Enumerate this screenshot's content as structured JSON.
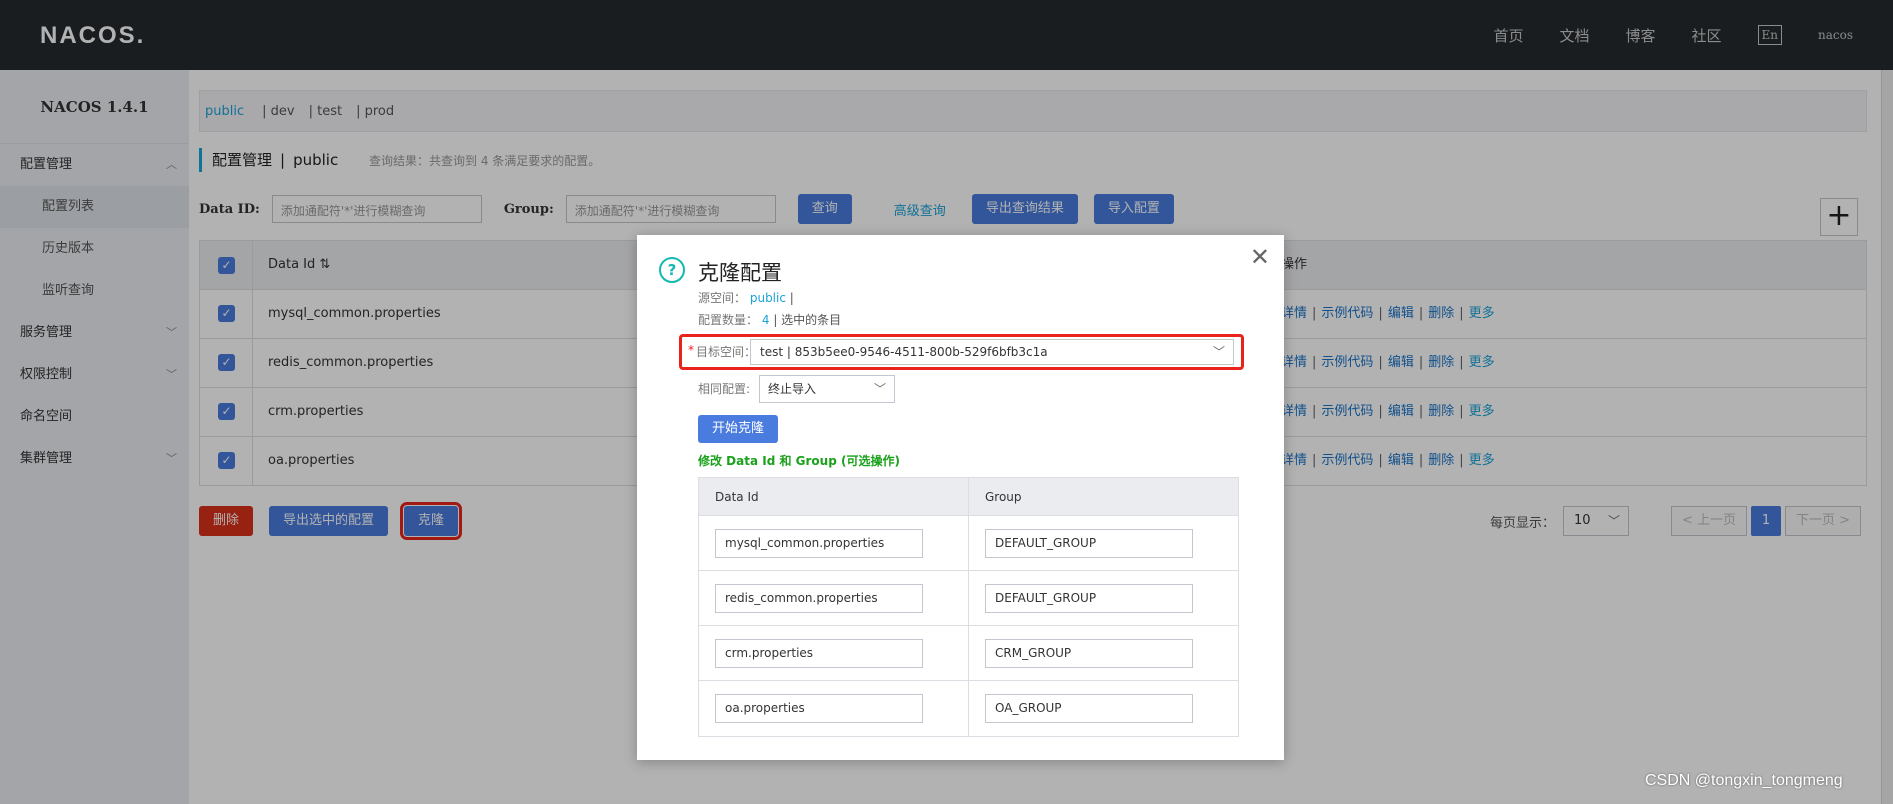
{
  "header": {
    "logo": "NACOS.",
    "nav": [
      "首页",
      "文档",
      "博客",
      "社区"
    ],
    "lang": "En",
    "user": "nacos"
  },
  "sidebar": {
    "version": "NACOS 1.4.1",
    "items": [
      {
        "label": "配置管理",
        "type": "group",
        "chevron": "^"
      },
      {
        "label": "配置列表",
        "type": "sub",
        "active": true
      },
      {
        "label": "历史版本",
        "type": "sub"
      },
      {
        "label": "监听查询",
        "type": "sub"
      },
      {
        "label": "服务管理",
        "type": "group",
        "chevron": "v"
      },
      {
        "label": "权限控制",
        "type": "group",
        "chevron": "v"
      },
      {
        "label": "命名空间",
        "type": "group"
      },
      {
        "label": "集群管理",
        "type": "group",
        "chevron": "v"
      }
    ]
  },
  "namespace_tabs": [
    "public",
    "| dev",
    "| test",
    "| prod"
  ],
  "page": {
    "title": "配置管理",
    "sep": "|",
    "namespace": "public",
    "hint": "查询结果：共查询到 4 条满足要求的配置。"
  },
  "search": {
    "dataid_label": "Data ID:",
    "dataid_placeholder": "添加通配符'*'进行模糊查询",
    "group_label": "Group:",
    "group_placeholder": "添加通配符'*'进行模糊查询",
    "query_btn": "查询",
    "advanced_link": "高级查询",
    "export_btn": "导出查询结果",
    "import_btn": "导入配置",
    "plus": "+"
  },
  "table": {
    "col_dataid": "Data Id",
    "sort_icon": "⇅",
    "col_ops": "操作",
    "rows": [
      {
        "data_id": "mysql_common.properties"
      },
      {
        "data_id": "redis_common.properties"
      },
      {
        "data_id": "crm.properties"
      },
      {
        "data_id": "oa.properties"
      }
    ],
    "ops": [
      "详情",
      "示例代码",
      "编辑",
      "删除",
      "更多"
    ],
    "ops_sep": "|"
  },
  "actions": {
    "delete": "删除",
    "export_selected": "导出选中的配置",
    "clone": "克隆"
  },
  "pager": {
    "per_page_label": "每页显示：",
    "per_page": "10",
    "prev": "< 上一页",
    "current": "1",
    "next": "下一页 >"
  },
  "dialog": {
    "title": "克隆配置",
    "source_label": "源空间：",
    "source_value": "public",
    "source_sep": "|",
    "count_label": "配置数量：",
    "count_value": "4",
    "count_suffix": "| 选中的条目",
    "target_required": "*",
    "target_label": "目标空间：",
    "target_value": "test | 853b5ee0-9546-4511-800b-529f6bfb3c1a",
    "same_label": "相同配置:",
    "same_value": "终止导入",
    "start_btn": "开始克隆",
    "edit_hint": "修改 Data Id 和 Group (可选操作)",
    "col_dataid": "Data Id",
    "col_group": "Group",
    "rows": [
      {
        "data_id": "mysql_common.properties",
        "group": "DEFAULT_GROUP"
      },
      {
        "data_id": "redis_common.properties",
        "group": "DEFAULT_GROUP"
      },
      {
        "data_id": "crm.properties",
        "group": "CRM_GROUP"
      },
      {
        "data_id": "oa.properties",
        "group": "OA_GROUP"
      }
    ]
  },
  "watermark": "CSDN @tongxin_tongmeng",
  "colors": {
    "header_bg": "#252a2f",
    "primary": "#4a7bdf",
    "danger": "#d9311a",
    "link": "#1aa3d8",
    "highlight": "#e8231b",
    "success": "#1ba11b"
  }
}
